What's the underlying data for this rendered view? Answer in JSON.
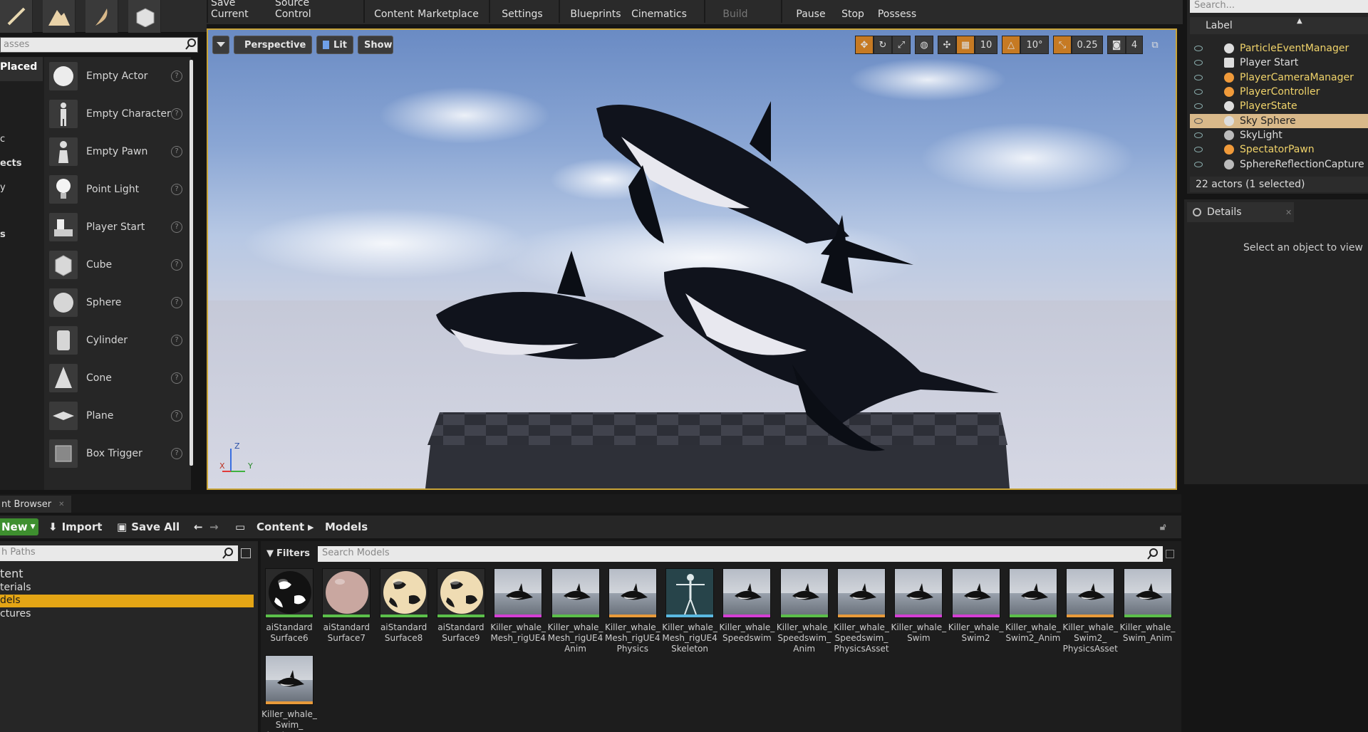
{
  "toolbar": {
    "buttons": [
      "Save Current",
      "Source Control",
      "Content",
      "Marketplace",
      "Settings",
      "Blueprints",
      "Cinematics",
      "Build",
      "Pause",
      "Stop",
      "Possess"
    ]
  },
  "modes": {
    "search_placeholder": "asses",
    "categories": [
      "Placed",
      "c",
      "ects",
      "y",
      "s"
    ],
    "items": [
      "Empty Actor",
      "Empty Character",
      "Empty Pawn",
      "Point Light",
      "Player Start",
      "Cube",
      "Sphere",
      "Cylinder",
      "Cone",
      "Plane",
      "Box Trigger"
    ]
  },
  "viewport": {
    "view_mode": "Perspective",
    "lighting": "Lit",
    "show": "Show",
    "grid_snap": "10",
    "rot_snap": "10°",
    "scale_snap": "0.25",
    "camera_speed": "4",
    "axis_labels": [
      "Z",
      "X",
      "Y"
    ]
  },
  "outliner": {
    "search_placeholder": "Search...",
    "column": "Label",
    "rows": [
      {
        "label": "ParticleEventManager",
        "color": "#f0d36a"
      },
      {
        "label": "Player Start",
        "color": "#dddddd"
      },
      {
        "label": "PlayerCameraManager",
        "color": "#f0d36a"
      },
      {
        "label": "PlayerController",
        "color": "#f0d36a"
      },
      {
        "label": "PlayerState",
        "color": "#f0d36a"
      },
      {
        "label": "Sky Sphere",
        "color": "#ffffff"
      },
      {
        "label": "SkyLight",
        "color": "#dddddd"
      },
      {
        "label": "SpectatorPawn",
        "color": "#f0d36a"
      },
      {
        "label": "SphereReflectionCapture",
        "color": "#dddddd"
      }
    ],
    "footer": "22 actors (1 selected)"
  },
  "details": {
    "tab": "Details",
    "message": "Select an object to view"
  },
  "content_browser": {
    "tab": "nt Browser",
    "new": "New",
    "import": "Import",
    "save_all": "Save All",
    "breadcrumb": [
      "Content",
      "Models"
    ],
    "paths_placeholder": "h Paths",
    "tree": [
      "tent",
      "terials",
      "dels",
      "ctures"
    ],
    "filters": "Filters",
    "search_placeholder": "Search Models",
    "assets": [
      {
        "label": "aiStandard Surface6",
        "kind": "mat-black",
        "bar": "#5bbf4a"
      },
      {
        "label": "aiStandard Surface7",
        "kind": "mat-pink",
        "bar": "#5bbf4a"
      },
      {
        "label": "aiStandard Surface8",
        "kind": "mat-cream",
        "bar": "#5bbf4a"
      },
      {
        "label": "aiStandard Surface9",
        "kind": "mat-cream",
        "bar": "#5bbf4a"
      },
      {
        "label": "Killer_whale_ Mesh_rigUE4",
        "kind": "mesh",
        "bar": "#d43fd4"
      },
      {
        "label": "Killer_whale_ Mesh_rigUE4 Anim",
        "kind": "mesh",
        "bar": "#5bbf4a"
      },
      {
        "label": "Killer_whale_ Mesh_rigUE4 Physics",
        "kind": "mesh",
        "bar": "#e89a3a"
      },
      {
        "label": "Killer_whale_ Mesh_rigUE4 Skeleton",
        "kind": "skeleton",
        "bar": "#5ab8e0"
      },
      {
        "label": "Killer_whale_ Speedswim",
        "kind": "mesh",
        "bar": "#d43fd4"
      },
      {
        "label": "Killer_whale_ Speedswim_ Anim",
        "kind": "mesh",
        "bar": "#5bbf4a"
      },
      {
        "label": "Killer_whale_ Speedswim_ PhysicsAsset",
        "kind": "mesh",
        "bar": "#e89a3a"
      },
      {
        "label": "Killer_whale_ Swim",
        "kind": "mesh",
        "bar": "#d43fd4"
      },
      {
        "label": "Killer_whale_ Swim2",
        "kind": "mesh",
        "bar": "#d43fd4"
      },
      {
        "label": "Killer_whale_ Swim2_Anim",
        "kind": "mesh",
        "bar": "#5bbf4a"
      },
      {
        "label": "Killer_whale_ Swim2_ PhysicsAsset",
        "kind": "mesh",
        "bar": "#e89a3a"
      },
      {
        "label": "Killer_whale_ Swim_Anim",
        "kind": "mesh",
        "bar": "#5bbf4a"
      },
      {
        "label": "Killer_whale_ Swim_ PhysicsAsset",
        "kind": "mesh",
        "bar": "#e89a3a"
      }
    ]
  }
}
